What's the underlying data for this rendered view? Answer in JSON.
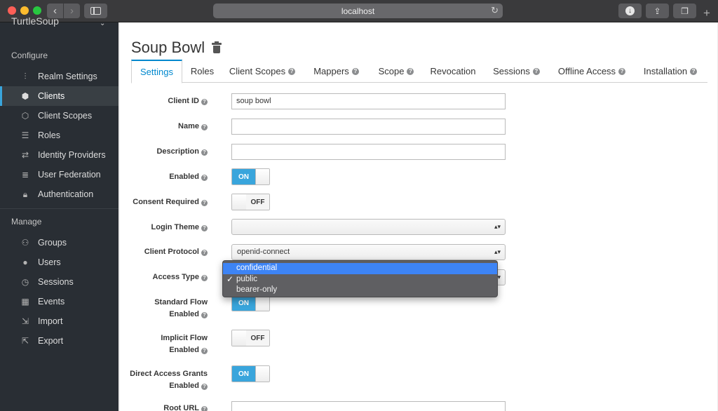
{
  "browser": {
    "url": "localhost"
  },
  "sidebar": {
    "realm": "TurtleSoup",
    "configure_heading": "Configure",
    "manage_heading": "Manage",
    "configure_items": [
      {
        "label": "Realm Settings",
        "icon": "sliders-icon"
      },
      {
        "label": "Clients",
        "icon": "cube-icon",
        "active": true
      },
      {
        "label": "Client Scopes",
        "icon": "cubes-icon"
      },
      {
        "label": "Roles",
        "icon": "list-icon"
      },
      {
        "label": "Identity Providers",
        "icon": "exchange-icon"
      },
      {
        "label": "User Federation",
        "icon": "database-icon"
      },
      {
        "label": "Authentication",
        "icon": "lock-icon"
      }
    ],
    "manage_items": [
      {
        "label": "Groups",
        "icon": "users-icon"
      },
      {
        "label": "Users",
        "icon": "user-icon"
      },
      {
        "label": "Sessions",
        "icon": "clock-icon"
      },
      {
        "label": "Events",
        "icon": "calendar-icon"
      },
      {
        "label": "Import",
        "icon": "import-icon"
      },
      {
        "label": "Export",
        "icon": "export-icon"
      }
    ]
  },
  "page": {
    "title": "Soup Bowl"
  },
  "tabs": [
    {
      "label": "Settings",
      "active": true,
      "help": false
    },
    {
      "label": "Roles",
      "help": false
    },
    {
      "label": "Client Scopes",
      "help": true
    },
    {
      "label": "Mappers",
      "help": true
    },
    {
      "label": "Scope",
      "help": true
    },
    {
      "label": "Revocation",
      "help": false
    },
    {
      "label": "Sessions",
      "help": true
    },
    {
      "label": "Offline Access",
      "help": true
    },
    {
      "label": "Installation",
      "help": true
    }
  ],
  "form": {
    "client_id": {
      "label": "Client ID",
      "value": "soup bowl"
    },
    "name": {
      "label": "Name",
      "value": ""
    },
    "description": {
      "label": "Description",
      "value": ""
    },
    "enabled": {
      "label": "Enabled",
      "state": "ON"
    },
    "consent_required": {
      "label": "Consent Required",
      "state": "OFF"
    },
    "login_theme": {
      "label": "Login Theme",
      "value": ""
    },
    "client_protocol": {
      "label": "Client Protocol",
      "value": "openid-connect"
    },
    "access_type": {
      "label": "Access Type",
      "value": "public"
    },
    "standard_flow": {
      "label_line1": "Standard Flow",
      "label_line2": "Enabled",
      "state": "ON"
    },
    "implicit_flow": {
      "label_line1": "Implicit Flow",
      "label_line2": "Enabled",
      "state": "OFF"
    },
    "direct_access": {
      "label_line1": "Direct Access Grants",
      "label_line2": "Enabled",
      "state": "ON"
    },
    "root_url": {
      "label": "Root URL",
      "value": ""
    }
  },
  "access_type_dropdown": {
    "options": [
      "confidential",
      "public",
      "bearer-only"
    ],
    "highlighted": "confidential",
    "checked": "public"
  },
  "colors": {
    "accent": "#0088ce",
    "switch_on": "#39a5dc",
    "sidebar_bg": "#292e34",
    "dropdown_highlight": "#3d84f5"
  }
}
